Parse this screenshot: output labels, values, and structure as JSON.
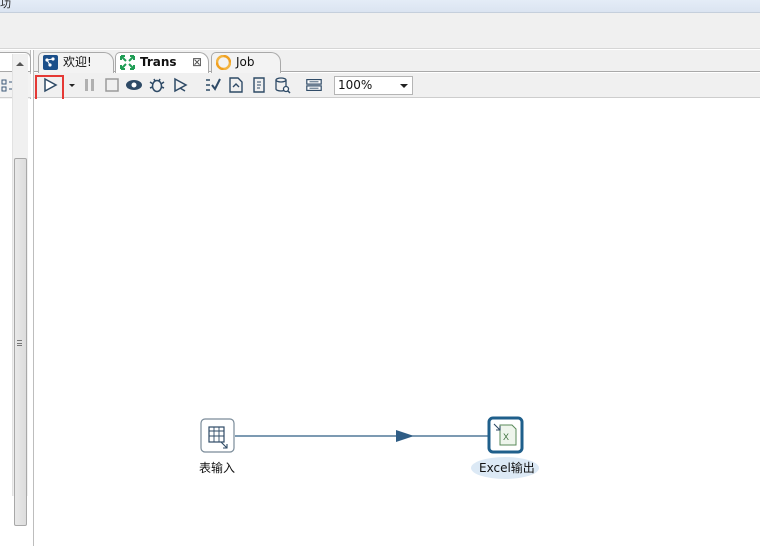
{
  "menu": {
    "clipped_glyph": "功"
  },
  "tabs": [
    {
      "label": "欢迎!",
      "icon": "spoon-icon"
    },
    {
      "label": "Trans",
      "icon": "transformation-icon",
      "active": true
    },
    {
      "label": "Job",
      "icon": "job-icon"
    }
  ],
  "toolbar": {
    "buttons": [
      "run-icon",
      "run-options-dropdown-icon",
      "pause-icon",
      "stop-icon",
      "preview-icon",
      "debug-icon",
      "replay-icon",
      "verify-icon",
      "impact-icon",
      "sql-icon",
      "explore-db-icon",
      "show-results-icon"
    ],
    "zoom": "100%"
  },
  "canvas": {
    "steps": [
      {
        "label": "表输入",
        "icon": "table-input-icon"
      },
      {
        "label": "Excel输出",
        "icon": "excel-output-icon",
        "selected": true
      }
    ],
    "hops": [
      {
        "from": "表输入",
        "to": "Excel输出"
      }
    ]
  },
  "colors": {
    "hop": "#2f5d85",
    "selection": "#e53935",
    "step_border": "#1f5f8b",
    "selected_label_bg": "#dce9f5"
  }
}
